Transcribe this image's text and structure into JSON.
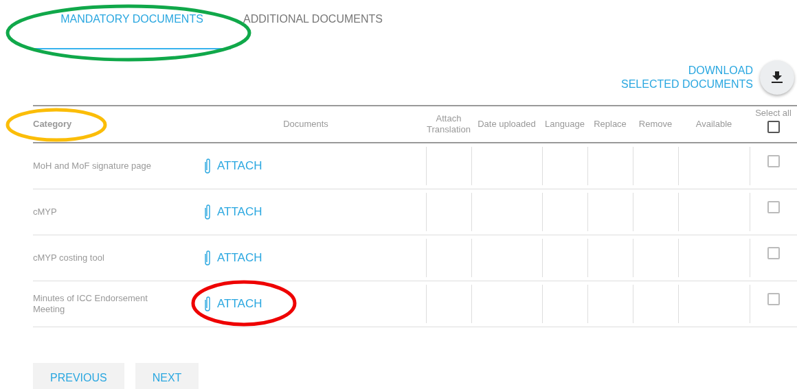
{
  "tabs": [
    {
      "label": "MANDATORY DOCUMENTS",
      "selected": true,
      "color": "#10a84a"
    },
    {
      "label": "ADDITIONAL DOCUMENTS",
      "selected": false
    }
  ],
  "download": {
    "label_lines": [
      "DOWNLOAD",
      "SELECTED DOCUMENTS"
    ]
  },
  "table": {
    "columns": [
      {
        "label": "Category",
        "bold": true,
        "color": "#fbbd08"
      },
      {
        "label": "Documents"
      },
      {
        "label": "Attach Translation"
      },
      {
        "label": "Date uploaded"
      },
      {
        "label": "Language"
      },
      {
        "label": "Replace"
      },
      {
        "label": "Remove"
      },
      {
        "label": "Available"
      },
      {
        "label": "Select all",
        "checked": false
      }
    ],
    "rows": [
      {
        "category": "MoH and MoF signature page",
        "action": "ATTACH",
        "checked": false
      },
      {
        "category": "cMYP",
        "action": "ATTACH",
        "checked": false
      },
      {
        "category": "cMYP costing tool",
        "action": "ATTACH",
        "checked": false
      },
      {
        "category": "Minutes of ICC Endorsement Meeting",
        "action": "ATTACH",
        "checked": false,
        "color": "#ee0000"
      }
    ]
  },
  "buttons": [
    "PREVIOUS",
    "NEXT"
  ]
}
